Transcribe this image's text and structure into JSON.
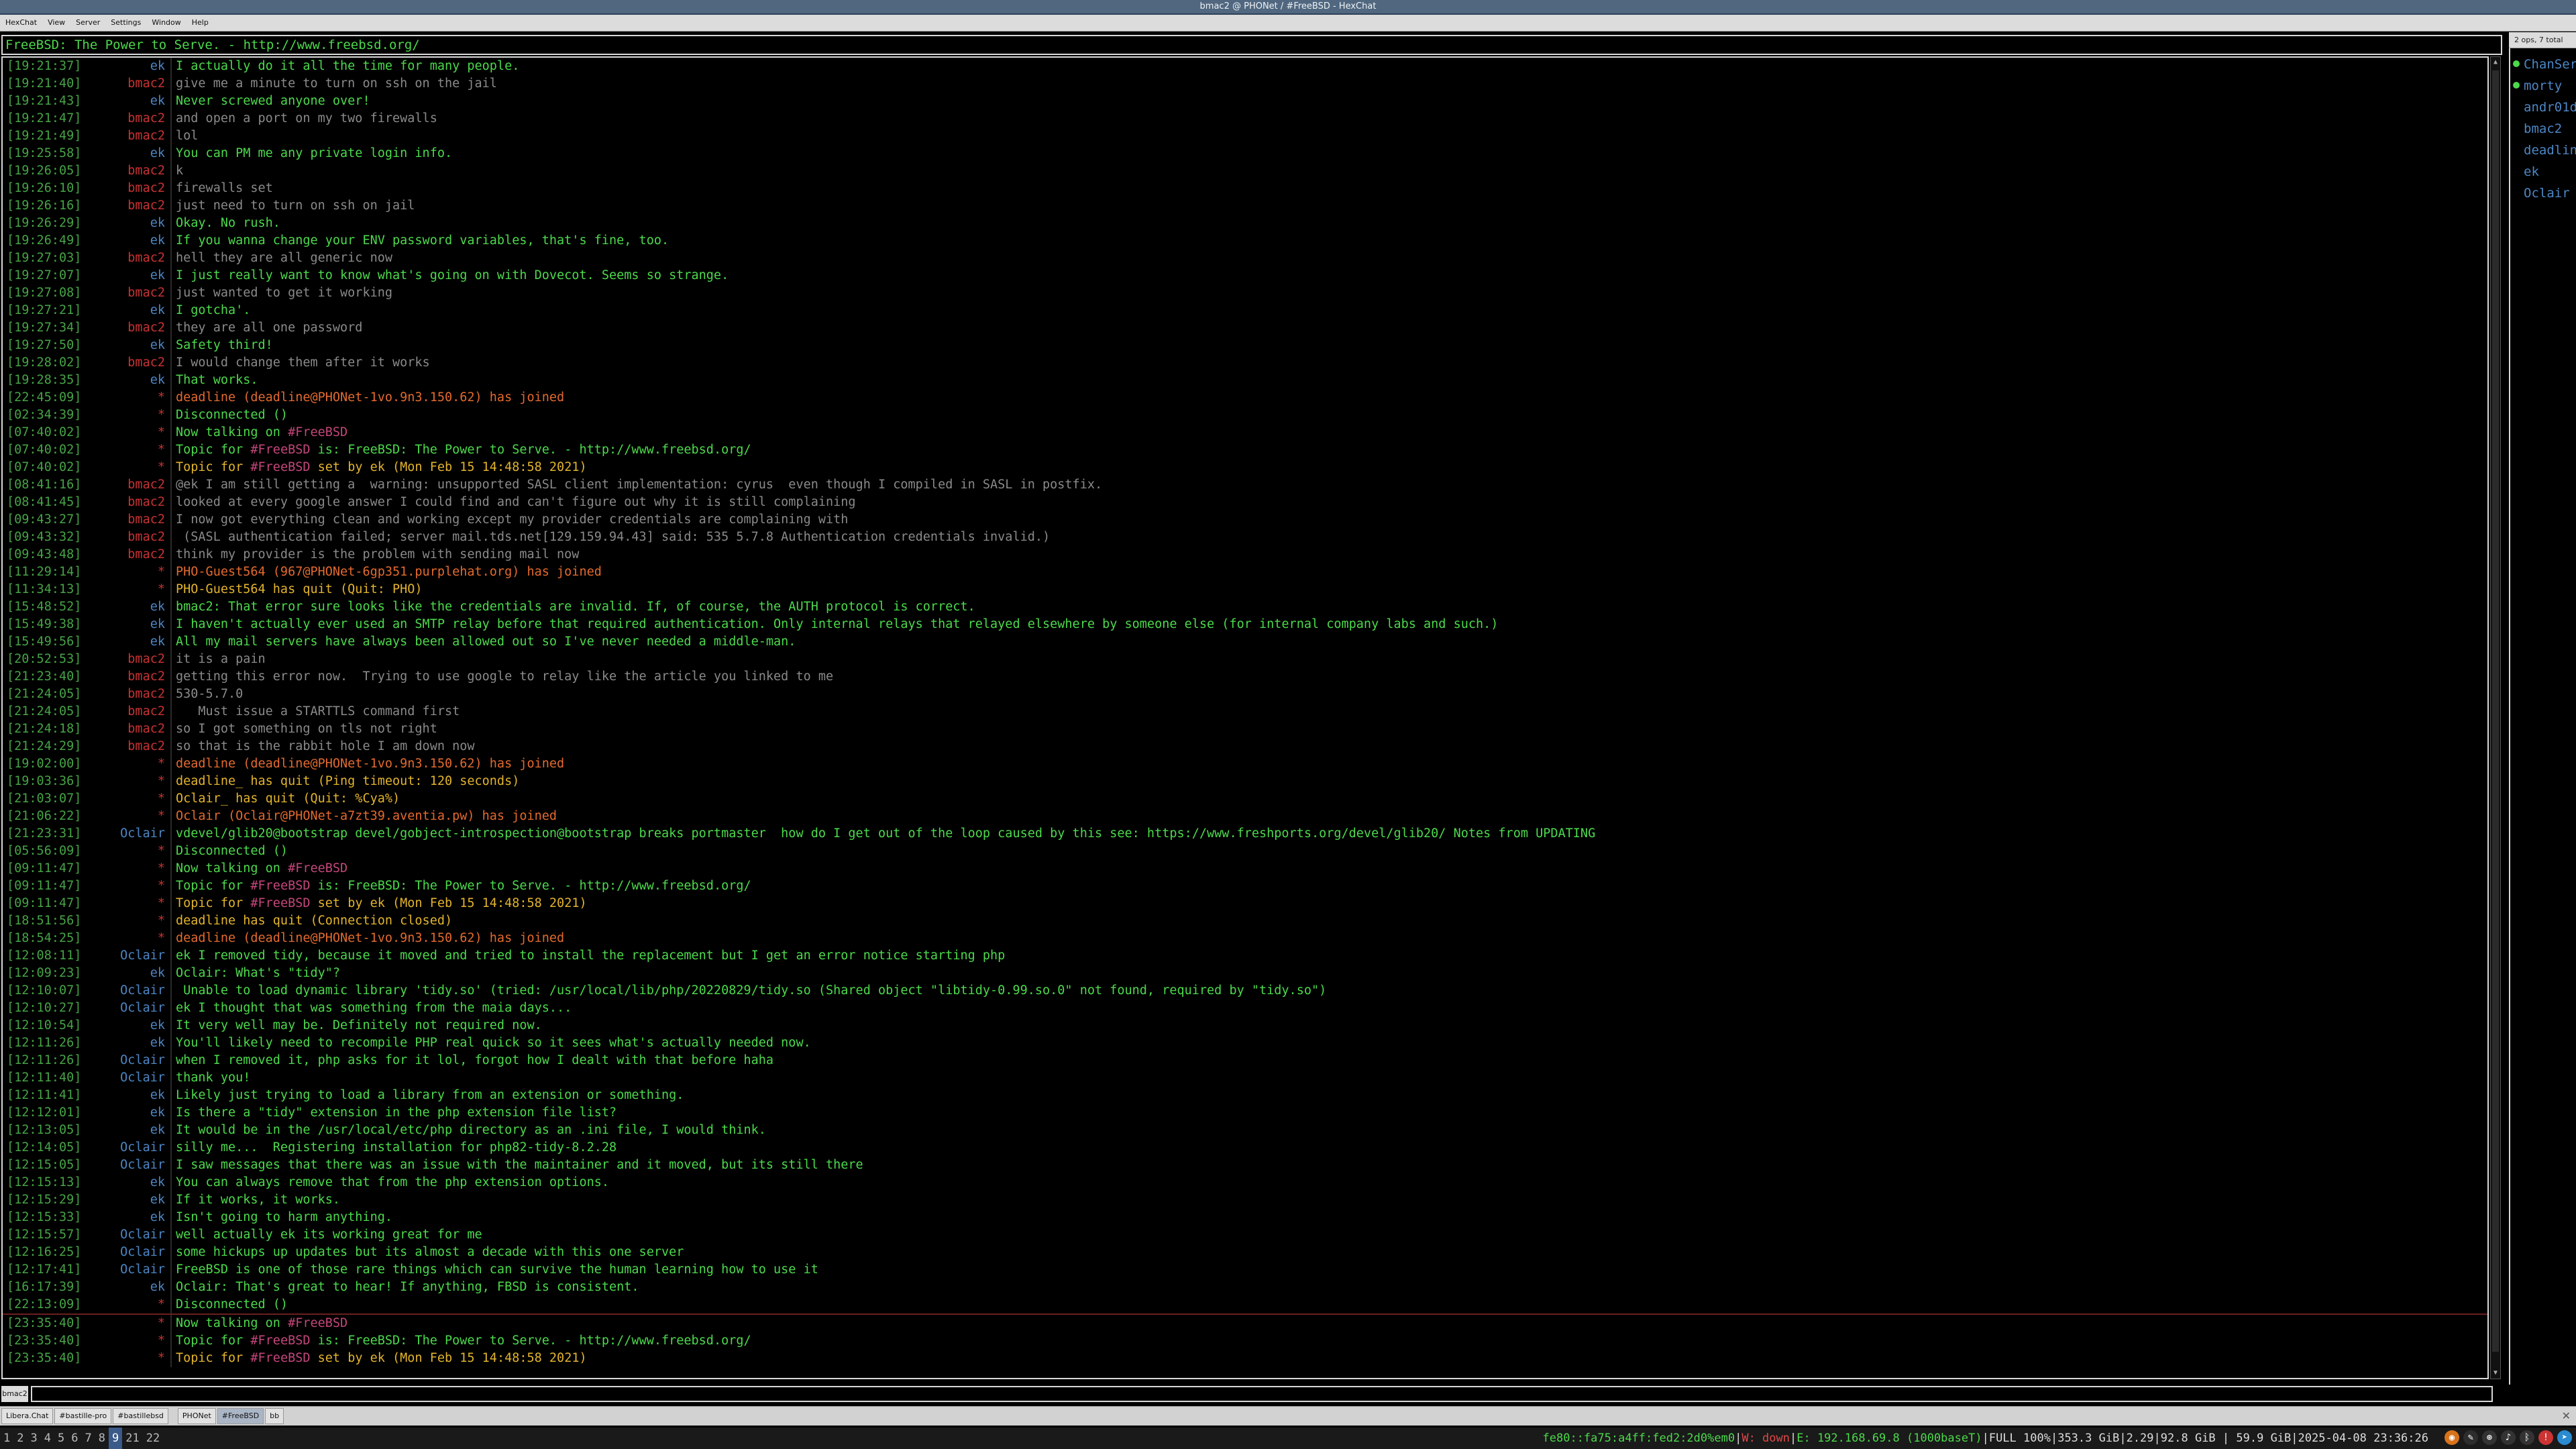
{
  "window": {
    "title": "bmac2 @ PHONet / #FreeBSD - HexChat"
  },
  "menu": [
    "HexChat",
    "View",
    "Server",
    "Settings",
    "Window",
    "Help"
  ],
  "topic": "FreeBSD: The Power to Serve. - http://www.freebsd.org/",
  "userlist": {
    "header": "2 ops, 7 total",
    "users": [
      {
        "nick": "ChanServ",
        "op": true
      },
      {
        "nick": "morty",
        "op": true
      },
      {
        "nick": "andr01d",
        "op": false
      },
      {
        "nick": "bmac2",
        "op": false
      },
      {
        "nick": "deadline",
        "op": false
      },
      {
        "nick": "ek",
        "op": false
      },
      {
        "nick": "Oclair",
        "op": false
      }
    ]
  },
  "messages": [
    {
      "t": "[19:21:37]",
      "n": "ek",
      "k": "ek",
      "m": "I actually do it all the time for many people."
    },
    {
      "t": "[19:21:40]",
      "n": "bmac2",
      "k": "bmac2",
      "m": "give me a minute to turn on ssh on the jail"
    },
    {
      "t": "[19:21:43]",
      "n": "ek",
      "k": "ek",
      "m": "Never screwed anyone over!"
    },
    {
      "t": "[19:21:47]",
      "n": "bmac2",
      "k": "bmac2",
      "m": "and open a port on my two firewalls"
    },
    {
      "t": "[19:21:49]",
      "n": "bmac2",
      "k": "bmac2",
      "m": "lol"
    },
    {
      "t": "[19:25:58]",
      "n": "ek",
      "k": "ek",
      "m": "You can PM me any private login info."
    },
    {
      "t": "[19:26:05]",
      "n": "bmac2",
      "k": "bmac2",
      "m": "k"
    },
    {
      "t": "[19:26:10]",
      "n": "bmac2",
      "k": "bmac2",
      "m": "firewalls set"
    },
    {
      "t": "[19:26:16]",
      "n": "bmac2",
      "k": "bmac2",
      "m": "just need to turn on ssh on jail"
    },
    {
      "t": "[19:26:29]",
      "n": "ek",
      "k": "ek",
      "m": "Okay. No rush."
    },
    {
      "t": "[19:26:49]",
      "n": "ek",
      "k": "ek",
      "m": "If you wanna change your ENV password variables, that's fine, too."
    },
    {
      "t": "[19:27:03]",
      "n": "bmac2",
      "k": "bmac2",
      "m": "hell they are all generic now"
    },
    {
      "t": "[19:27:07]",
      "n": "ek",
      "k": "ek",
      "m": "I just really want to know what's going on with Dovecot. Seems so strange."
    },
    {
      "t": "[19:27:08]",
      "n": "bmac2",
      "k": "bmac2",
      "m": "just wanted to get it working"
    },
    {
      "t": "[19:27:21]",
      "n": "ek",
      "k": "ek",
      "m": "I gotcha'."
    },
    {
      "t": "[19:27:34]",
      "n": "bmac2",
      "k": "bmac2",
      "m": "they are all one password"
    },
    {
      "t": "[19:27:50]",
      "n": "ek",
      "k": "ek",
      "m": "Safety third!"
    },
    {
      "t": "[19:28:02]",
      "n": "bmac2",
      "k": "bmac2",
      "m": "I would change them after it works"
    },
    {
      "t": "[19:28:35]",
      "n": "ek",
      "k": "ek",
      "m": "That works."
    },
    {
      "t": "[22:45:09]",
      "n": "*",
      "k": "join",
      "m": "deadline (deadline@PHONet-1vo.9n3.150.62) has joined"
    },
    {
      "t": "[02:34:39]",
      "n": "*",
      "k": "info",
      "m": "Disconnected ()"
    },
    {
      "t": "[07:40:02]",
      "n": "*",
      "k": "nowtalk",
      "m": "Now talking on ",
      "chan": "#FreeBSD",
      "post": ""
    },
    {
      "t": "[07:40:02]",
      "n": "*",
      "k": "topic",
      "m": "Topic for ",
      "chan": "#FreeBSD",
      "post": " is: FreeBSD: The Power to Serve. - http://www.freebsd.org/"
    },
    {
      "t": "[07:40:02]",
      "n": "*",
      "k": "topicset",
      "m": "Topic for ",
      "chan": "#FreeBSD",
      "post": " set by ek (Mon Feb 15 14:48:58 2021)"
    },
    {
      "t": "[08:41:16]",
      "n": "bmac2",
      "k": "bmac2",
      "m": "@ek I am still getting a  warning: unsupported SASL client implementation: cyrus  even though I compiled in SASL in postfix."
    },
    {
      "t": "[08:41:45]",
      "n": "bmac2",
      "k": "bmac2",
      "m": "looked at every google answer I could find and can't figure out why it is still complaining"
    },
    {
      "t": "[09:43:27]",
      "n": "bmac2",
      "k": "bmac2",
      "m": "I now got everything clean and working except my provider credentials are complaining with"
    },
    {
      "t": "[09:43:32]",
      "n": "bmac2",
      "k": "bmac2",
      "m": " (SASL authentication failed; server mail.tds.net[129.159.94.43] said: 535 5.7.8 Authentication credentials invalid.)"
    },
    {
      "t": "[09:43:48]",
      "n": "bmac2",
      "k": "bmac2",
      "m": "think my provider is the problem with sending mail now"
    },
    {
      "t": "[11:29:14]",
      "n": "*",
      "k": "join",
      "m": "PHO-Guest564 (967@PHONet-6gp351.purplehat.org) has joined"
    },
    {
      "t": "[11:34:13]",
      "n": "*",
      "k": "quit",
      "m": "PHO-Guest564 has quit (Quit: PHO)"
    },
    {
      "t": "[15:48:52]",
      "n": "ek",
      "k": "ek",
      "m": "bmac2: That error sure looks like the credentials are invalid. If, of course, the AUTH protocol is correct."
    },
    {
      "t": "[15:49:38]",
      "n": "ek",
      "k": "ek",
      "m": "I haven't actually ever used an SMTP relay before that required authentication. Only internal relays that relayed elsewhere by someone else (for internal company labs and such.)"
    },
    {
      "t": "[15:49:56]",
      "n": "ek",
      "k": "ek",
      "m": "All my mail servers have always been allowed out so I've never needed a middle-man."
    },
    {
      "t": "[20:52:53]",
      "n": "bmac2",
      "k": "bmac2",
      "m": "it is a pain"
    },
    {
      "t": "[21:23:40]",
      "n": "bmac2",
      "k": "bmac2",
      "m": "getting this error now.  Trying to use google to relay like the article you linked to me"
    },
    {
      "t": "[21:24:05]",
      "n": "bmac2",
      "k": "bmac2",
      "m": "530-5.7.0"
    },
    {
      "t": "[21:24:05]",
      "n": "bmac2",
      "k": "bmac2",
      "m": "   Must issue a STARTTLS command first"
    },
    {
      "t": "[21:24:18]",
      "n": "bmac2",
      "k": "bmac2",
      "m": "so I got something on tls not right"
    },
    {
      "t": "[21:24:29]",
      "n": "bmac2",
      "k": "bmac2",
      "m": "so that is the rabbit hole I am down now"
    },
    {
      "t": "[19:02:00]",
      "n": "*",
      "k": "join",
      "m": "deadline (deadline@PHONet-1vo.9n3.150.62) has joined"
    },
    {
      "t": "[19:03:36]",
      "n": "*",
      "k": "quit",
      "m": "deadline_ has quit (Ping timeout: 120 seconds)"
    },
    {
      "t": "[21:03:07]",
      "n": "*",
      "k": "quit",
      "m": "Oclair_ has quit (Quit: %Cya%)"
    },
    {
      "t": "[21:06:22]",
      "n": "*",
      "k": "join",
      "m": "Oclair (Oclair@PHONet-a7zt39.aventia.pw) has joined"
    },
    {
      "t": "[21:23:31]",
      "n": "Oclair",
      "k": "Oclair",
      "m": "vdevel/glib20@bootstrap devel/gobject-introspection@bootstrap breaks portmaster  how do I get out of the loop caused by this see: https://www.freshports.org/devel/glib20/ Notes from UPDATING"
    },
    {
      "t": "[05:56:09]",
      "n": "*",
      "k": "info",
      "m": "Disconnected ()"
    },
    {
      "t": "[09:11:47]",
      "n": "*",
      "k": "nowtalk",
      "m": "Now talking on ",
      "chan": "#FreeBSD",
      "post": ""
    },
    {
      "t": "[09:11:47]",
      "n": "*",
      "k": "topic",
      "m": "Topic for ",
      "chan": "#FreeBSD",
      "post": " is: FreeBSD: The Power to Serve. - http://www.freebsd.org/"
    },
    {
      "t": "[09:11:47]",
      "n": "*",
      "k": "topicset",
      "m": "Topic for ",
      "chan": "#FreeBSD",
      "post": " set by ek (Mon Feb 15 14:48:58 2021)"
    },
    {
      "t": "[18:51:56]",
      "n": "*",
      "k": "quit",
      "m": "deadline has quit (Connection closed)"
    },
    {
      "t": "[18:54:25]",
      "n": "*",
      "k": "join",
      "m": "deadline (deadline@PHONet-1vo.9n3.150.62) has joined"
    },
    {
      "t": "[12:08:11]",
      "n": "Oclair",
      "k": "Oclair",
      "m": "ek I removed tidy, because it moved and tried to install the replacement but I get an error notice starting php"
    },
    {
      "t": "[12:09:23]",
      "n": "ek",
      "k": "ek",
      "m": "Oclair: What's \"tidy\"?"
    },
    {
      "t": "[12:10:07]",
      "n": "Oclair",
      "k": "Oclair",
      "m": " Unable to load dynamic library 'tidy.so' (tried: /usr/local/lib/php/20220829/tidy.so (Shared object \"libtidy-0.99.so.0\" not found, required by \"tidy.so\")"
    },
    {
      "t": "[12:10:27]",
      "n": "Oclair",
      "k": "Oclair",
      "m": "ek I thought that was something from the maia days..."
    },
    {
      "t": "[12:10:54]",
      "n": "ek",
      "k": "ek",
      "m": "It very well may be. Definitely not required now."
    },
    {
      "t": "[12:11:26]",
      "n": "ek",
      "k": "ek",
      "m": "You'll likely need to recompile PHP real quick so it sees what's actually needed now."
    },
    {
      "t": "[12:11:26]",
      "n": "Oclair",
      "k": "Oclair",
      "m": "when I removed it, php asks for it lol, forgot how I dealt with that before haha"
    },
    {
      "t": "[12:11:40]",
      "n": "Oclair",
      "k": "Oclair",
      "m": "thank you!"
    },
    {
      "t": "[12:11:41]",
      "n": "ek",
      "k": "ek",
      "m": "Likely just trying to load a library from an extension or something."
    },
    {
      "t": "[12:12:01]",
      "n": "ek",
      "k": "ek",
      "m": "Is there a \"tidy\" extension in the php extension file list?"
    },
    {
      "t": "[12:13:05]",
      "n": "ek",
      "k": "ek",
      "m": "It would be in the /usr/local/etc/php directory as an .ini file, I would think."
    },
    {
      "t": "[12:14:05]",
      "n": "Oclair",
      "k": "Oclair",
      "m": "silly me...  Registering installation for php82-tidy-8.2.28"
    },
    {
      "t": "[12:15:05]",
      "n": "Oclair",
      "k": "Oclair",
      "m": "I saw messages that there was an issue with the maintainer and it moved, but its still there"
    },
    {
      "t": "[12:15:13]",
      "n": "ek",
      "k": "ek",
      "m": "You can always remove that from the php extension options."
    },
    {
      "t": "[12:15:29]",
      "n": "ek",
      "k": "ek",
      "m": "If it works, it works."
    },
    {
      "t": "[12:15:33]",
      "n": "ek",
      "k": "ek",
      "m": "Isn't going to harm anything."
    },
    {
      "t": "[12:15:57]",
      "n": "Oclair",
      "k": "Oclair",
      "m": "well actually ek its working great for me"
    },
    {
      "t": "[12:16:25]",
      "n": "Oclair",
      "k": "Oclair",
      "m": "some hickups up updates but its almost a decade with this one server"
    },
    {
      "t": "[12:17:41]",
      "n": "Oclair",
      "k": "Oclair",
      "m": "FreeBSD is one of those rare things which can survive the human learning how to use it"
    },
    {
      "t": "[16:17:39]",
      "n": "ek",
      "k": "ek",
      "m": "Oclair: That's great to hear! If anything, FBSD is consistent."
    },
    {
      "t": "[22:13:09]",
      "n": "*",
      "k": "info",
      "m": "Disconnected ()"
    },
    {
      "t": "[23:35:40]",
      "n": "*",
      "k": "nowtalk",
      "m": "Now talking on ",
      "chan": "#FreeBSD",
      "post": "",
      "marker": true
    },
    {
      "t": "[23:35:40]",
      "n": "*",
      "k": "topic",
      "m": "Topic for ",
      "chan": "#FreeBSD",
      "post": " is: FreeBSD: The Power to Serve. - http://www.freebsd.org/"
    },
    {
      "t": "[23:35:40]",
      "n": "*",
      "k": "topicset",
      "m": "Topic for ",
      "chan": "#FreeBSD",
      "post": " set by ek (Mon Feb 15 14:48:58 2021)"
    }
  ],
  "input": {
    "nick": "bmac2",
    "value": ""
  },
  "tabs": [
    {
      "label": "Libera.Chat",
      "active": false,
      "sep": false
    },
    {
      "label": "#bastille-pro",
      "active": false,
      "sep": false
    },
    {
      "label": "#bastillebsd",
      "active": false,
      "sep": false
    },
    {
      "label": "PHONet",
      "active": false,
      "sep": true
    },
    {
      "label": "#FreeBSD",
      "active": true,
      "sep": false
    },
    {
      "label": "bb",
      "active": false,
      "sep": false
    }
  ],
  "workspaces": [
    {
      "label": "1",
      "active": false
    },
    {
      "label": "2",
      "active": false
    },
    {
      "label": "3",
      "active": false
    },
    {
      "label": "4",
      "active": false
    },
    {
      "label": "5",
      "active": false
    },
    {
      "label": "6",
      "active": false
    },
    {
      "label": "7",
      "active": false
    },
    {
      "label": "8",
      "active": false
    },
    {
      "label": "9",
      "active": true
    },
    {
      "label": "21",
      "active": false
    },
    {
      "label": "22",
      "active": false
    }
  ],
  "statusbar": {
    "ipv6": "fe80::fa75:a4ff:fed2:2d0%em0",
    "wifi": "W: down",
    "eth": "E: 192.168.69.8 (1000baseT)",
    "battery": "FULL 100%",
    "disk": "353.3 GiB",
    "load": "2.29",
    "mem": "92.8 GiB",
    "disk2": "59.9 GiB",
    "datetime": "2025-04-08 23:36:26"
  }
}
